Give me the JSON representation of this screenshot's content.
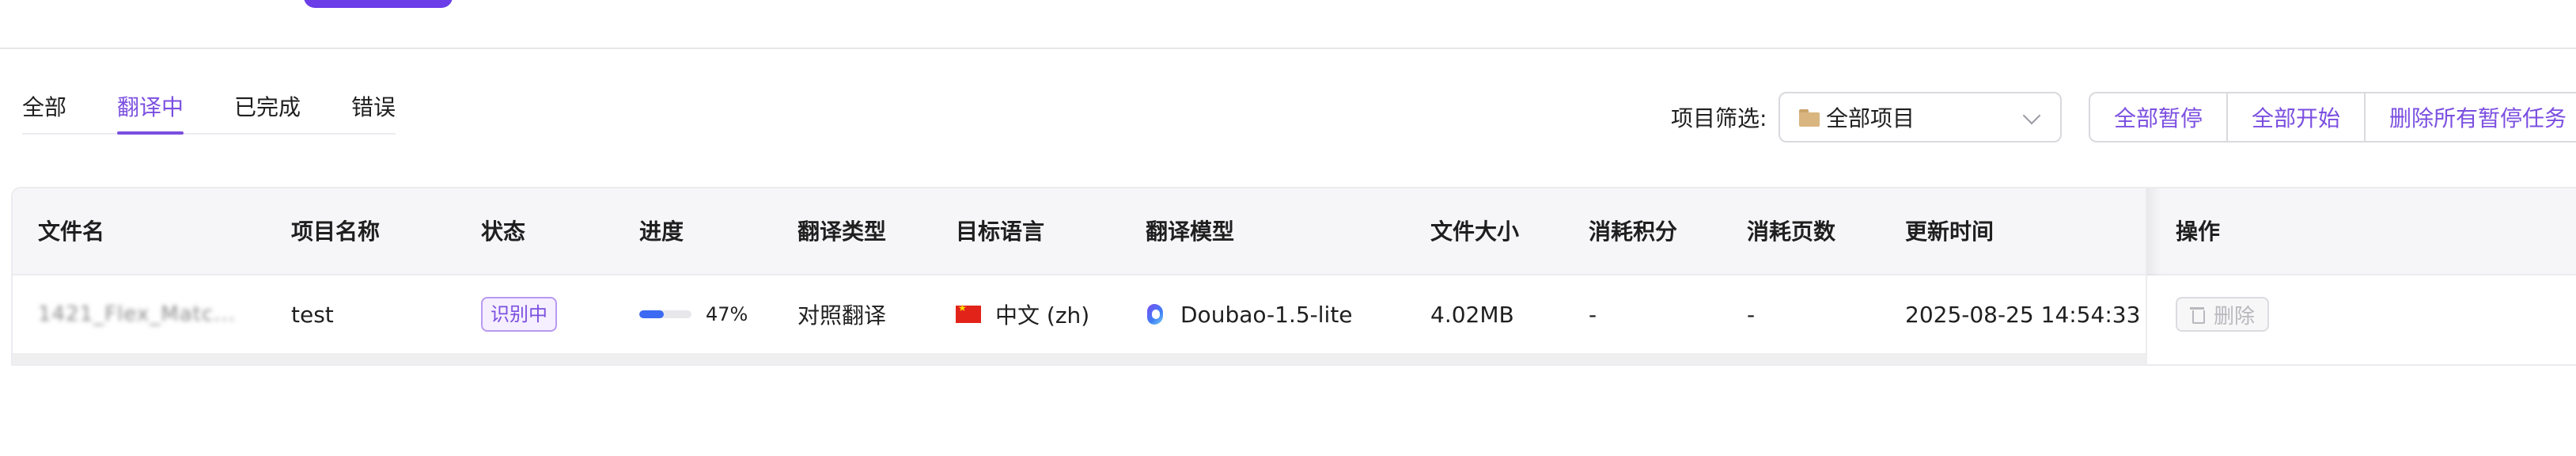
{
  "tabs": [
    {
      "label": "全部"
    },
    {
      "label": "翻译中",
      "active": true
    },
    {
      "label": "已完成"
    },
    {
      "label": "错误"
    }
  ],
  "filter": {
    "label": "项目筛选:",
    "selected": "全部项目"
  },
  "actions": {
    "pause_all": "全部暂停",
    "start_all": "全部开始",
    "delete_paused": "删除所有暂停任务"
  },
  "table": {
    "columns": {
      "file_name": "文件名",
      "project_name": "项目名称",
      "status": "状态",
      "progress": "进度",
      "translation_type": "翻译类型",
      "target_language": "目标语言",
      "model": "翻译模型",
      "file_size": "文件大小",
      "credits": "消耗积分",
      "pages": "消耗页数",
      "updated": "更新时间",
      "actions": "操作"
    },
    "rows": [
      {
        "file_name": "1421_Flex_Matc...",
        "project_name": "test",
        "status": "识别中",
        "progress_percent": 47,
        "progress_text": "47%",
        "translation_type": "对照翻译",
        "target_language": "中文 (zh)",
        "model": "Doubao-1.5-lite",
        "file_size": "4.02MB",
        "credits": "-",
        "pages": "-",
        "updated": "2025-08-25 14:54:33",
        "delete_label": "删除"
      }
    ]
  },
  "colors": {
    "accent": "#7b4fe0",
    "progress": "#3d6af2",
    "top_button": "#6a3de8"
  }
}
